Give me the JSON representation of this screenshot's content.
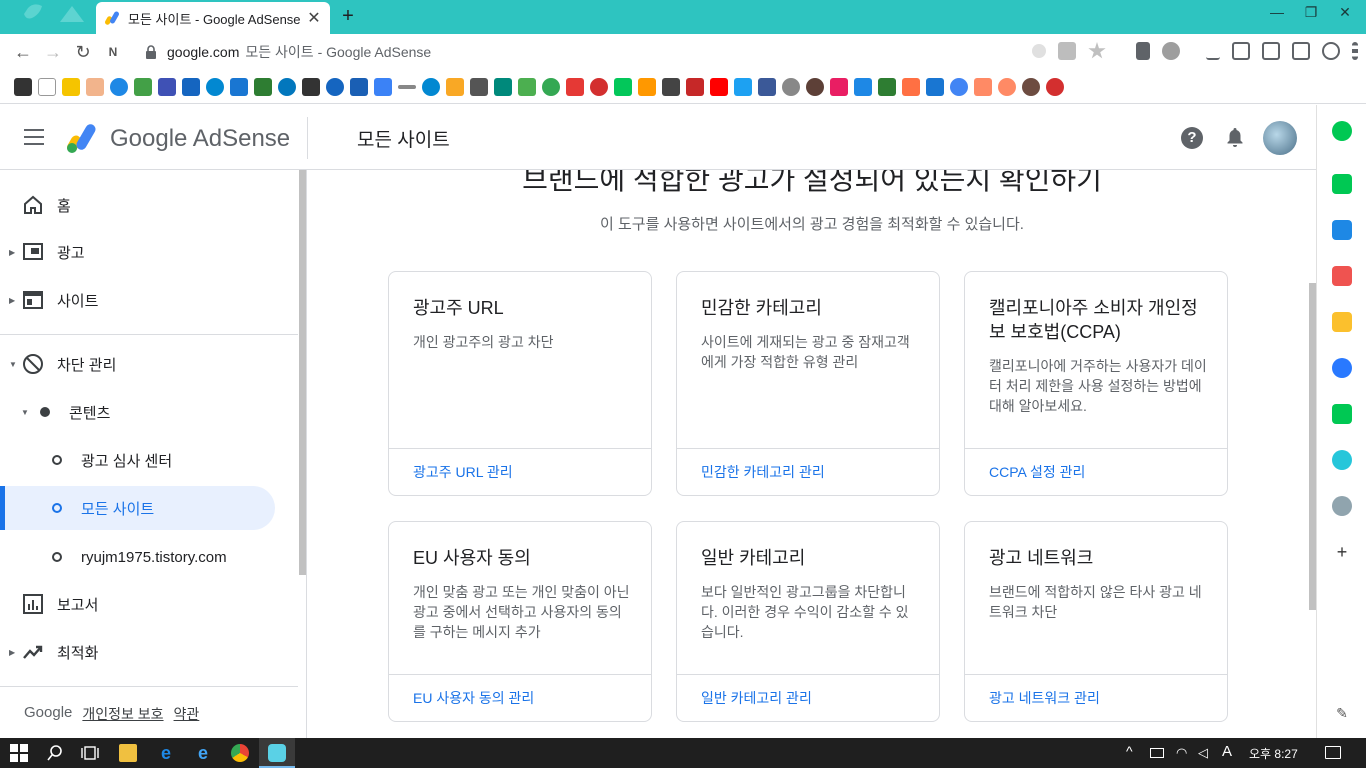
{
  "browser": {
    "tab_title": "모든 사이트 - Google AdSense",
    "tab_close": "✕",
    "new_tab": "+",
    "url_host": "google.com",
    "url_rest": "모든 사이트 - Google AdSense"
  },
  "header": {
    "brand": "Google AdSense",
    "page_title": "모든 사이트",
    "help": "?"
  },
  "sidebar": {
    "items": [
      {
        "label": "홈"
      },
      {
        "label": "광고"
      },
      {
        "label": "사이트"
      },
      {
        "label": "차단 관리"
      },
      {
        "label": "콘텐츠"
      },
      {
        "label": "광고 심사 센터"
      },
      {
        "label": "모든 사이트"
      },
      {
        "label": "ryujm1975.tistory.com"
      },
      {
        "label": "보고서"
      },
      {
        "label": "최적화"
      }
    ],
    "footer": {
      "google": "Google",
      "privacy": "개인정보 보호",
      "terms": "약관"
    }
  },
  "main": {
    "title": "브랜드에 적합한 광고가 설정되어 있는지 확인하기",
    "subtitle": "이 도구를 사용하면 사이트에서의 광고 경험을 최적화할 수 있습니다.",
    "cards": [
      {
        "title": "광고주 URL",
        "desc": "개인 광고주의 광고 차단",
        "link": "광고주 URL 관리"
      },
      {
        "title": "민감한 카테고리",
        "desc": "사이트에 게재되는 광고 중 잠재고객에게 가장 적합한 유형 관리",
        "link": "민감한 카테고리 관리"
      },
      {
        "title": "캘리포니아주 소비자 개인정보 보호법(CCPA)",
        "desc": "캘리포니아에 거주하는 사용자가 데이터 처리 제한을 사용 설정하는 방법에 대해 알아보세요.",
        "link": "CCPA 설정 관리"
      },
      {
        "title": "EU 사용자 동의",
        "desc": "개인 맞춤 광고 또는 개인 맞춤이 아닌 광고 중에서 선택하고 사용자의 동의를 구하는 메시지 추가",
        "link": "EU 사용자 동의 관리"
      },
      {
        "title": "일반 카테고리",
        "desc": "보다 일반적인 광고그룹을 차단합니다. 이러한 경우 수익이 감소할 수 있습니다.",
        "link": "일반 카테고리 관리"
      },
      {
        "title": "광고 네트워크",
        "desc": "브랜드에 적합하지 않은 타사 광고 네트워크 차단",
        "link": "광고 네트워크 관리"
      }
    ]
  },
  "taskbar": {
    "ime": "A",
    "clock": "오후 8:27"
  },
  "colors": {
    "accent": "#1a73e8",
    "tabbar": "#2ec4c0",
    "selected_bg": "#e8f0fe"
  }
}
